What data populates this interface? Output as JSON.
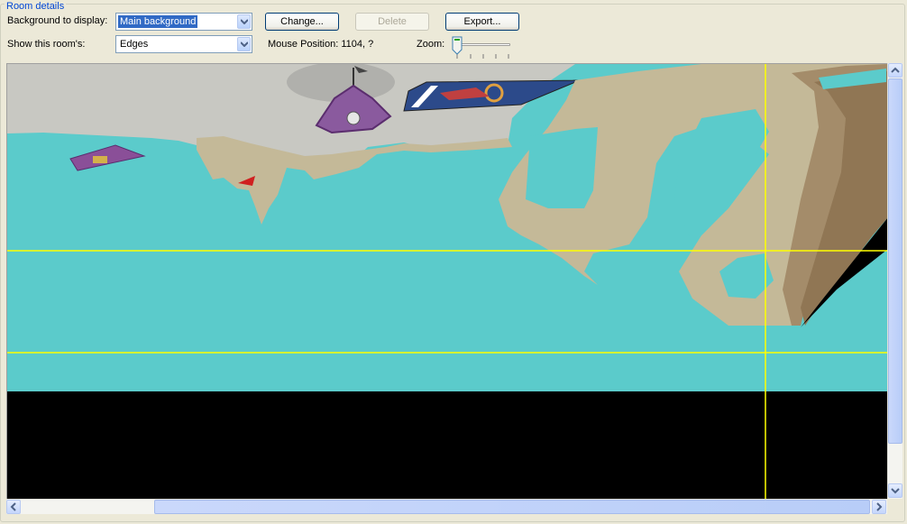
{
  "group": {
    "title": "Room details"
  },
  "background": {
    "label": "Background to display:",
    "selected": "Main background"
  },
  "show": {
    "label": "Show this room's:",
    "selected": "Edges"
  },
  "buttons": {
    "change": "Change...",
    "delete": "Delete",
    "export": "Export..."
  },
  "mouse": {
    "label": "Mouse Position: 1104, ?"
  },
  "zoom": {
    "label": "Zoom:",
    "level": 0
  },
  "colors": {
    "sky": "#5bcbcb",
    "floor": "#000000",
    "edge_line": "#ffff00",
    "selection": "#316ac5"
  },
  "icons": [
    "dropdown-arrow-icon",
    "scroll-up-icon",
    "scroll-down-icon",
    "scroll-left-icon",
    "scroll-right-icon"
  ]
}
